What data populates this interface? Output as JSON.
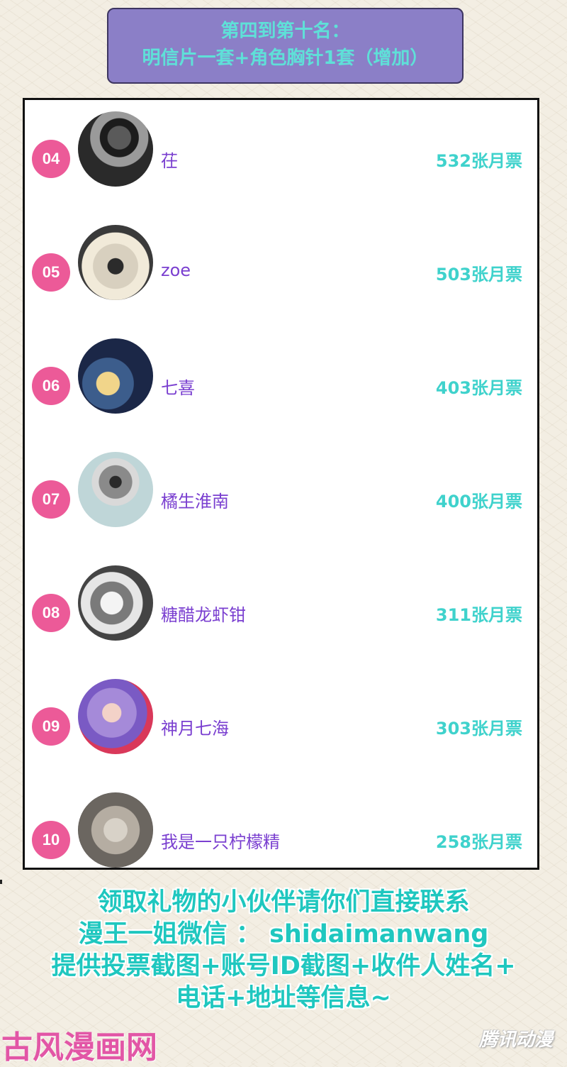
{
  "banner": {
    "line1": "第四到第十名：",
    "line2": "明信片一套+角色胸针1套（增加）"
  },
  "ranking": [
    {
      "rank": "04",
      "name": "茌",
      "votes": "532张月票"
    },
    {
      "rank": "05",
      "name": "zoe",
      "votes": "503张月票"
    },
    {
      "rank": "06",
      "name": "七喜",
      "votes": "403张月票"
    },
    {
      "rank": "07",
      "name": "橘生淮南",
      "votes": "400张月票"
    },
    {
      "rank": "08",
      "name": "糖醋龙虾钳",
      "votes": "311张月票"
    },
    {
      "rank": "09",
      "name": "神月七海",
      "votes": "303张月票"
    },
    {
      "rank": "10",
      "name": "我是一只柠檬精",
      "votes": "258张月票"
    }
  ],
  "footer": {
    "line1": "领取礼物的小伙伴请你们直接联系",
    "line2": "漫王一姐微信 ： shidaimanwang",
    "line3": "提供投票截图+账号ID截图+收件人姓名+",
    "line4": "电话+地址等信息~"
  },
  "watermarks": {
    "left": "古风漫画网",
    "right": "腾讯动漫"
  },
  "colors": {
    "banner_bg": "#8b7fc7",
    "banner_text": "#5fe0d8",
    "badge": "#ec5a98",
    "name": "#7a3fd0",
    "votes": "#3fd2cc",
    "footer_text": "#1fc7bf"
  }
}
